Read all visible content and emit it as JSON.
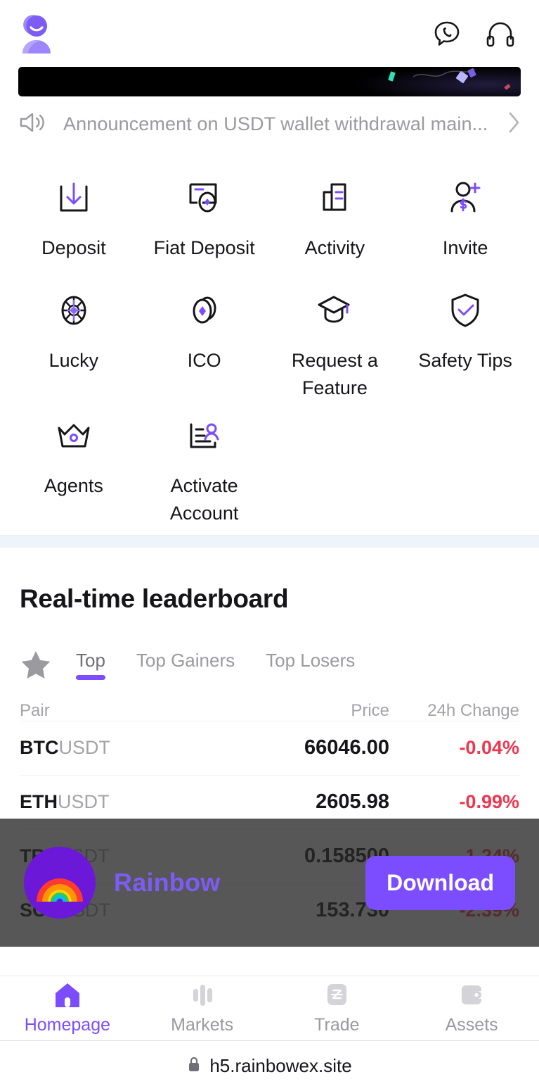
{
  "header": {
    "avatar_name": "user-avatar",
    "chat_icon": "chat-bubble-icon",
    "support_icon": "headset-icon"
  },
  "promo_banner": {
    "label": "promo-banner"
  },
  "announcement": {
    "speaker_icon": "speaker-icon",
    "text": "Announcement on USDT wallet withdrawal main...",
    "chevron_icon": "chevron-right-icon"
  },
  "quick_actions": [
    {
      "label": "Deposit",
      "icon": "deposit-icon"
    },
    {
      "label": "Fiat Deposit",
      "icon": "fiat-deposit-icon"
    },
    {
      "label": "Activity",
      "icon": "activity-icon"
    },
    {
      "label": "Invite",
      "icon": "invite-icon"
    },
    {
      "label": "Lucky",
      "icon": "lucky-wheel-icon"
    },
    {
      "label": "ICO",
      "icon": "ico-coin-icon"
    },
    {
      "label": "Request a Feature",
      "icon": "graduation-cap-icon"
    },
    {
      "label": "Safety Tips",
      "icon": "shield-check-icon"
    },
    {
      "label": "Agents",
      "icon": "crown-icon"
    },
    {
      "label": "Activate Account",
      "icon": "activate-account-icon"
    }
  ],
  "leaderboard": {
    "title": "Real-time leaderboard",
    "favorite_icon": "star-icon",
    "tabs": [
      {
        "label": "Top",
        "active": true
      },
      {
        "label": "Top Gainers",
        "active": false
      },
      {
        "label": "Top Losers",
        "active": false
      }
    ],
    "columns": {
      "pair": "Pair",
      "price": "Price",
      "change": "24h Change"
    },
    "rows": [
      {
        "base": "BTC",
        "quote": "USDT",
        "price": "66046.00",
        "change": "-0.04%",
        "direction": "neg"
      },
      {
        "base": "ETH",
        "quote": "USDT",
        "price": "2605.98",
        "change": "-0.99%",
        "direction": "neg"
      },
      {
        "base": "TRX",
        "quote": "USDT",
        "price": "0.158500",
        "change": "-1.24%",
        "direction": "neg"
      },
      {
        "base": "SOL",
        "quote": "USDT",
        "price": "153.730",
        "change": "-2.39%",
        "direction": "neg"
      }
    ]
  },
  "download_banner": {
    "logo_icon": "rainbow-logo-icon",
    "app_name": "Rainbow",
    "button_label": "Download"
  },
  "bottom_nav": [
    {
      "label": "Homepage",
      "icon": "home-icon",
      "active": true
    },
    {
      "label": "Markets",
      "icon": "markets-bars-icon",
      "active": false
    },
    {
      "label": "Trade",
      "icon": "trade-icon",
      "active": false
    },
    {
      "label": "Assets",
      "icon": "wallet-icon",
      "active": false
    }
  ],
  "browser": {
    "lock_icon": "lock-icon",
    "url": "h5.rainbowex.site"
  },
  "colors": {
    "accent": "#7c4dff",
    "negative": "#f0364f",
    "muted": "#9a9a9f",
    "text": "#16161a",
    "logo_bg": "#6b18d8",
    "band": "#eff3fb"
  }
}
